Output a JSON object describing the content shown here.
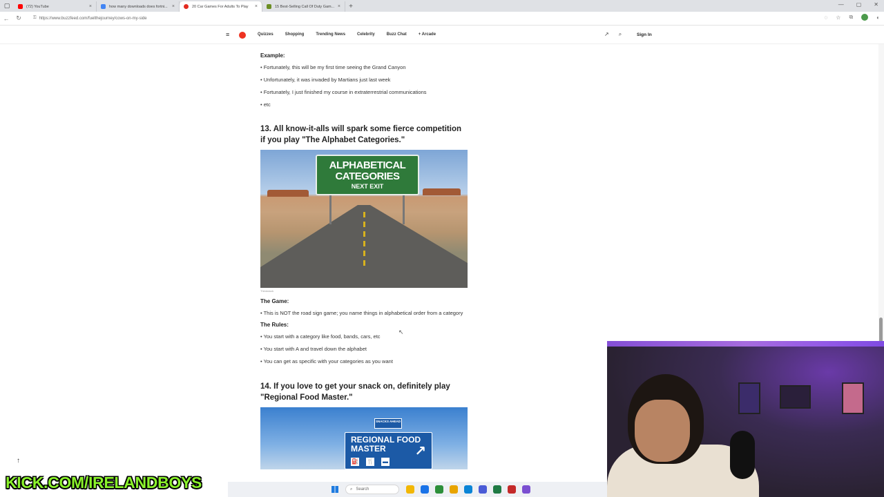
{
  "browser": {
    "tabs": [
      {
        "title": "(72) YouTube",
        "color": "#ff0000",
        "active": false
      },
      {
        "title": "how many downloads does fortni...",
        "color": "#4285f4",
        "active": false
      },
      {
        "title": "20 Car Games For Adults To Play",
        "color": "#e32b20",
        "active": true
      },
      {
        "title": "15 Best-Selling Call Of Duty Gam...",
        "color": "#6b8e23",
        "active": false
      }
    ],
    "url": "https://www.buzzfeed.com/fuelthejourney/cows-on-my-side"
  },
  "site_nav": {
    "links": [
      "Quizzes",
      "Shopping",
      "Trending News",
      "Celebrity",
      "Buzz Chat",
      "+ Arcade"
    ],
    "sign_in": "Sign In"
  },
  "article": {
    "example_label": "Example:",
    "example_bullets": [
      "• Fortunately, this will be my first time seeing the Grand Canyon",
      "• Unfortunately, it was invaded by Martians just last week",
      "• Fortunately, I just finished my course in extraterrestrial communications",
      "• etc"
    ],
    "section13": {
      "heading": "13. All know-it-alls will spark some fierce competition if you play \"The Alphabet Categories.\"",
      "sign_line1": "ALPHABETICAL",
      "sign_line2": "CATEGORIES",
      "sign_line3": "NEXT EXIT",
      "credit": "Thinkstock",
      "game_label": "The Game:",
      "game_text": "• This is NOT the road sign game; you name things in alphabetical order from a category",
      "rules_label": "The Rules:",
      "rules": [
        "• You start with a category like food, bands, cars, etc",
        "• You start with A and travel down the alphabet",
        "• You can get as specific with your categories as you want"
      ]
    },
    "section14": {
      "heading": "14. If you love to get your snack on, definitely play \"Regional Food Master.\"",
      "sign_top": "SNACKS AHEAD",
      "sign_line1": "REGIONAL FOOD",
      "sign_line2": "MASTER"
    }
  },
  "overlay": {
    "watermark": "KICK.COM/IRELANDBOYS"
  },
  "taskbar": {
    "search_placeholder": "Search",
    "app_colors": [
      "#f2b705",
      "#1a73e8",
      "#2d8f3a",
      "#e8a400",
      "#0a84d6",
      "#4a5bd6",
      "#1f7a44",
      "#c42a2a",
      "#7b4fd1"
    ]
  }
}
